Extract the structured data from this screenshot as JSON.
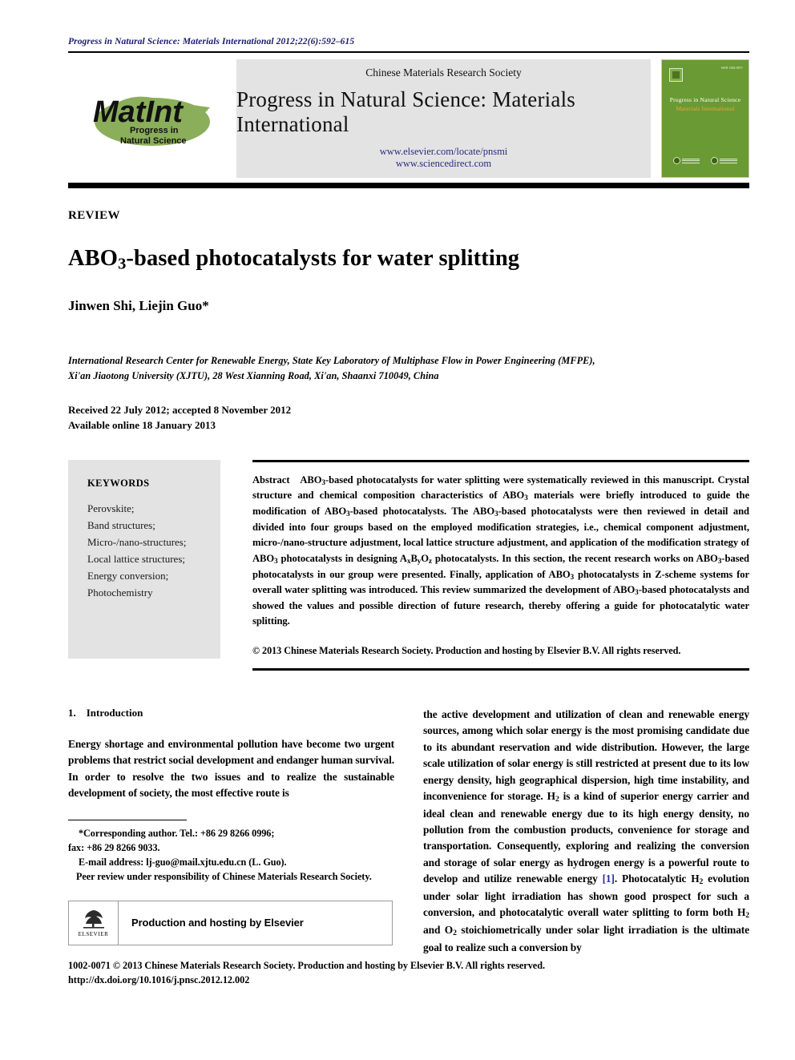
{
  "running_head": "Progress in Natural Science: Materials International 2012;22(6):592–615",
  "masthead": {
    "logo_main": "MatInt",
    "logo_sub_line1": "Progress in",
    "logo_sub_line2": "Natural Science",
    "society": "Chinese Materials Research Society",
    "journal_title": "Progress in Natural Science: Materials International",
    "url_elsevier": "www.elsevier.com/locate/pnsmi",
    "url_sciencedirect": "www.sciencedirect.com",
    "cover": {
      "issn": "ISSN 1002-0071",
      "title": "Progress in Natural Science",
      "subtitle": "Materials International"
    }
  },
  "article": {
    "type_label": "REVIEW",
    "title_pre": "ABO",
    "title_sub": "3",
    "title_post": "-based photocatalysts for water splitting",
    "authors": "Jinwen Shi, Liejin Guo*",
    "affiliation_line1": "International Research Center for Renewable Energy, State Key Laboratory of Multiphase Flow in Power Engineering (MFPE),",
    "affiliation_line2": "Xi'an Jiaotong University (XJTU), 28 West Xianning Road, Xi'an, Shaanxi 710049, China",
    "received": "Received 22 July 2012; accepted 8 November 2012",
    "available": "Available online 18 January 2013"
  },
  "keywords": {
    "heading": "KEYWORDS",
    "items": [
      "Perovskite;",
      "Band structures;",
      "Micro-/nano-structures;",
      "Local lattice structures;",
      "Energy conversion;",
      "Photochemistry"
    ]
  },
  "abstract": {
    "label": "Abstract",
    "text": "ABO3-based photocatalysts for water splitting were systematically reviewed in this manuscript. Crystal structure and chemical composition characteristics of ABO3 materials were briefly introduced to guide the modification of ABO3-based photocatalysts. The ABO3-based photocatalysts were then reviewed in detail and divided into four groups based on the employed modification strategies, i.e., chemical component adjustment, micro-/nano-structure adjustment, local lattice structure adjustment, and application of the modification strategy of ABO3 photocatalysts in designing AxByOz photocatalysts. In this section, the recent research works on ABO3-based photocatalysts in our group were presented. Finally, application of ABO3 photocatalysts in Z-scheme systems for overall water splitting was introduced. This review summarized the development of ABO3-based photocatalysts and showed the values and possible direction of future research, thereby offering a guide for photocatalytic water splitting.",
    "copyright": "© 2013 Chinese Materials Research Society. Production and hosting by Elsevier B.V. All rights reserved."
  },
  "section": {
    "number": "1.",
    "title": "Introduction",
    "left_paragraph": "Energy shortage and environmental pollution have become two urgent problems that restrict social development and endanger human survival. In order to resolve the two issues and to realize the sustainable development of society, the most effective route is",
    "right_paragraph_part1": "the active development and utilization of clean and renewable energy sources, among which solar energy is the most promising candidate due to its abundant reservation and wide distribution. However, the large scale utilization of solar energy is still restricted at present due to its low energy density, high geographical dispersion, high time instability, and inconvenience for storage. H2 is a kind of superior energy carrier and ideal clean and renewable energy due to its high energy density, no pollution from the combustion products, convenience for storage and transportation. Consequently, exploring and realizing the conversion and storage of solar energy as hydrogen energy is a powerful route to develop and utilize renewable energy",
    "citation": "[1]",
    "right_paragraph_part2": ". Photocatalytic H2 evolution under solar light irradiation has shown good prospect for such a conversion, and photocatalytic overall water splitting to form both H2 and O2 stoichiometrically under solar light irradiation is the ultimate goal to realize such a conversion by"
  },
  "footnotes": {
    "corresponding": "*Corresponding author. Tel.: +86 29 8266 0996;",
    "fax": "fax: +86 29 8266 9033.",
    "email": "E-mail address: lj-guo@mail.xjtu.edu.cn (L. Guo).",
    "peer_review": "Peer review under responsibility of Chinese Materials Research Society."
  },
  "elsevier_box": {
    "wordmark": "ELSEVIER",
    "text": "Production and hosting by Elsevier"
  },
  "page_footer": {
    "line1": "1002-0071 © 2013 Chinese Materials Research Society. Production and hosting by Elsevier B.V. All rights reserved.",
    "line2": "http://dx.doi.org/10.1016/j.pnsc.2012.12.002"
  }
}
